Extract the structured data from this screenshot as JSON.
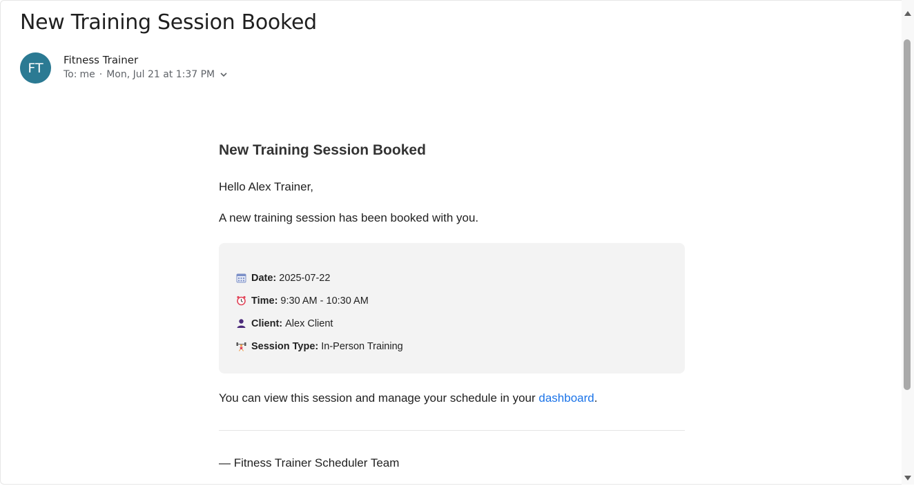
{
  "email": {
    "subject": "New Training Session Booked",
    "sender_initials": "FT",
    "sender_name": "Fitness Trainer",
    "to_label": "To:",
    "to_value": "me",
    "separator": "·",
    "date": "Mon, Jul 21 at 1:37 PM"
  },
  "body": {
    "heading": "New Training Session Booked",
    "greeting": "Hello Alex Trainer,",
    "intro": "A new training session has been booked with you.",
    "details": [
      {
        "icon": "calendar-icon",
        "label": "Date:",
        "value": "2025-07-22"
      },
      {
        "icon": "alarm-clock-icon",
        "label": "Time:",
        "value": "9:30 AM - 10:30 AM"
      },
      {
        "icon": "person-icon",
        "label": "Client:",
        "value": "Alex Client"
      },
      {
        "icon": "weightlifter-icon",
        "label": "Session Type:",
        "value": "In-Person Training"
      }
    ],
    "note_prefix": "You can view this session and manage your schedule in your ",
    "link_text": "dashboard",
    "note_suffix": ".",
    "signature": "— Fitness Trainer Scheduler Team"
  },
  "colors": {
    "avatar": "#2b7a93",
    "link": "#1a73e8",
    "details_bg": "#f3f3f3"
  }
}
